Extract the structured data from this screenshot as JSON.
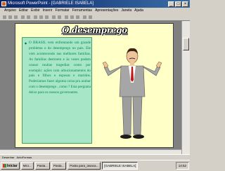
{
  "window": {
    "title": "Microsoft PowerPoint - [GABRIELE ISABELA]"
  },
  "menu": [
    "Arquivo",
    "Editar",
    "Exibir",
    "Inserir",
    "Formatar",
    "Ferramentas",
    "Apresentações",
    "Janela",
    "Ajuda"
  ],
  "slide": {
    "title": "O desemprego",
    "body": "O BRASIL vem enfrentando um grande problema o do desemprego no pais. Ele vem acontecendo nas melhores familias. As familias destroem e às vezes podem causar muitas tragedias como por exemplo: ações com arbucionamentos do pais e filhos e esposas e maridos. Poderíamos fazer alguma coisa pra acabar com o desemprego , como ? Esta pergunta deixo para os nossos governantes.",
    "bullet": "◆"
  },
  "drawbar": {
    "draw_label": "Desenhar",
    "autoshapes_label": "AutoFormas"
  },
  "taskbar": {
    "start_label": "Iniciar",
    "items": [
      "Micr...",
      "Pasta...",
      "Pasta...",
      "Pasta para_iasaca...",
      "[GABRIELE ISABELA]"
    ],
    "clock": "14:52"
  },
  "colors": {
    "title_bar": "#0a246a",
    "slide_bg": "#ffffc8",
    "text_box_bg": "#a8e6c8",
    "body_text": "#00844a"
  }
}
